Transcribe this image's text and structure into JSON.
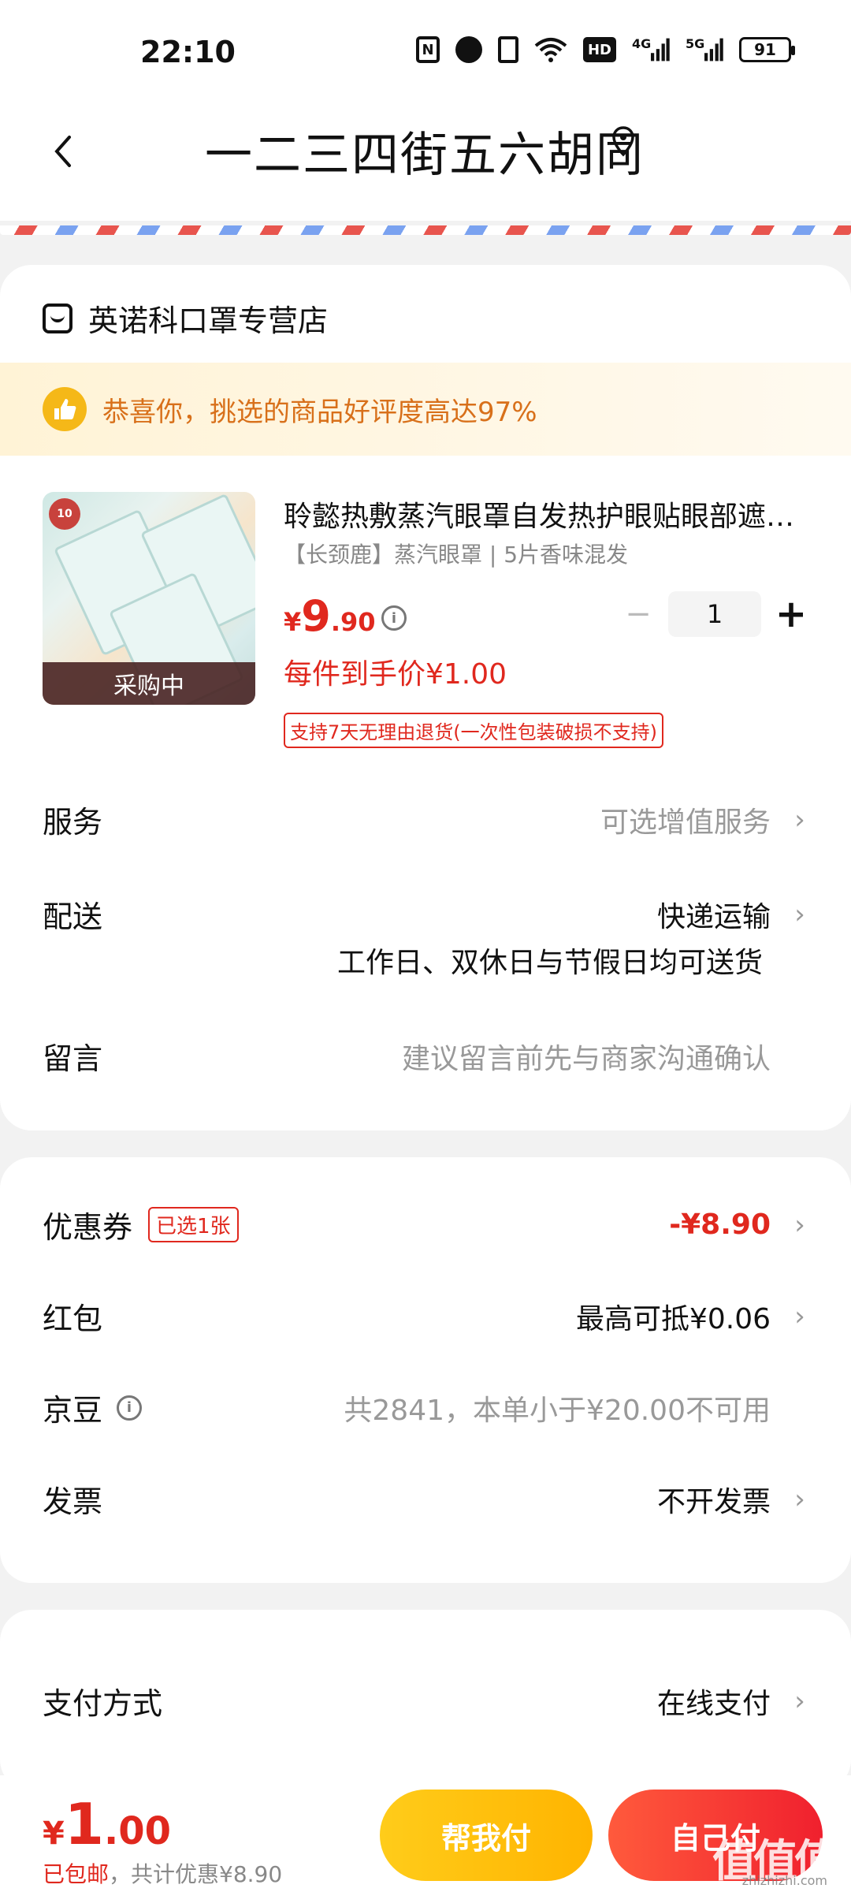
{
  "status_bar": {
    "time": "22:10",
    "battery": "91",
    "icons": [
      "nfc-icon",
      "alarm-icon",
      "vibrate-icon",
      "wifi-icon",
      "hd-icon",
      "signal-4g-icon",
      "signal-5g-icon",
      "battery-icon"
    ],
    "hd_label": "HD",
    "sig1_label": "4G",
    "sig2_label": "5G"
  },
  "header": {
    "title": "一二三四街五六胡同"
  },
  "store": {
    "name": "英诺科口罩专营店"
  },
  "praise_banner": {
    "text": "恭喜你，挑选的商品好评度高达97%"
  },
  "product": {
    "name": "聆懿热敷蒸汽眼罩自发热护眼贴眼部遮光睡眠眼罩",
    "spec": "【长颈鹿】蒸汽眼罩 | 5片香味混发",
    "price_currency": "¥",
    "price_int": "9",
    "price_dec": ".90",
    "quantity": "1",
    "unit_price": "每件到手价¥1.00",
    "return_policy": "支持7天无理由退货(一次性包装破损不支持)",
    "status_overlay": "采购中",
    "image_badge": "10"
  },
  "rows": {
    "service": {
      "label": "服务",
      "value": "可选增值服务"
    },
    "delivery": {
      "label": "配送",
      "value": "快递运输",
      "sub": "工作日、双休日与节假日均可送货"
    },
    "message": {
      "label": "留言",
      "placeholder": "建议留言前先与商家沟通确认"
    },
    "coupon": {
      "label": "优惠券",
      "tag": "已选1张",
      "value": "-¥8.90"
    },
    "red_packet": {
      "label": "红包",
      "value": "最高可抵¥0.06"
    },
    "jd_beans": {
      "label": "京豆",
      "value": "共2841，本单小于¥20.00不可用"
    },
    "invoice": {
      "label": "发票",
      "value": "不开发票"
    },
    "payment": {
      "label": "支付方式",
      "value": "在线支付"
    }
  },
  "bottom_bar": {
    "total_currency": "¥",
    "total_int": "1",
    "total_dec": ".00",
    "shipping_free": "已包邮",
    "discount_text": "，共计优惠¥8.90",
    "help_pay_label": "帮我付",
    "self_pay_label": "自己付"
  },
  "watermark": {
    "text": "值值值",
    "sub": "zhizhizhi.com"
  },
  "colors": {
    "accent_red": "#e0281e",
    "accent_yellow": "#ffb400",
    "praise_orange": "#d8701a",
    "background": "#f2f2f2"
  }
}
